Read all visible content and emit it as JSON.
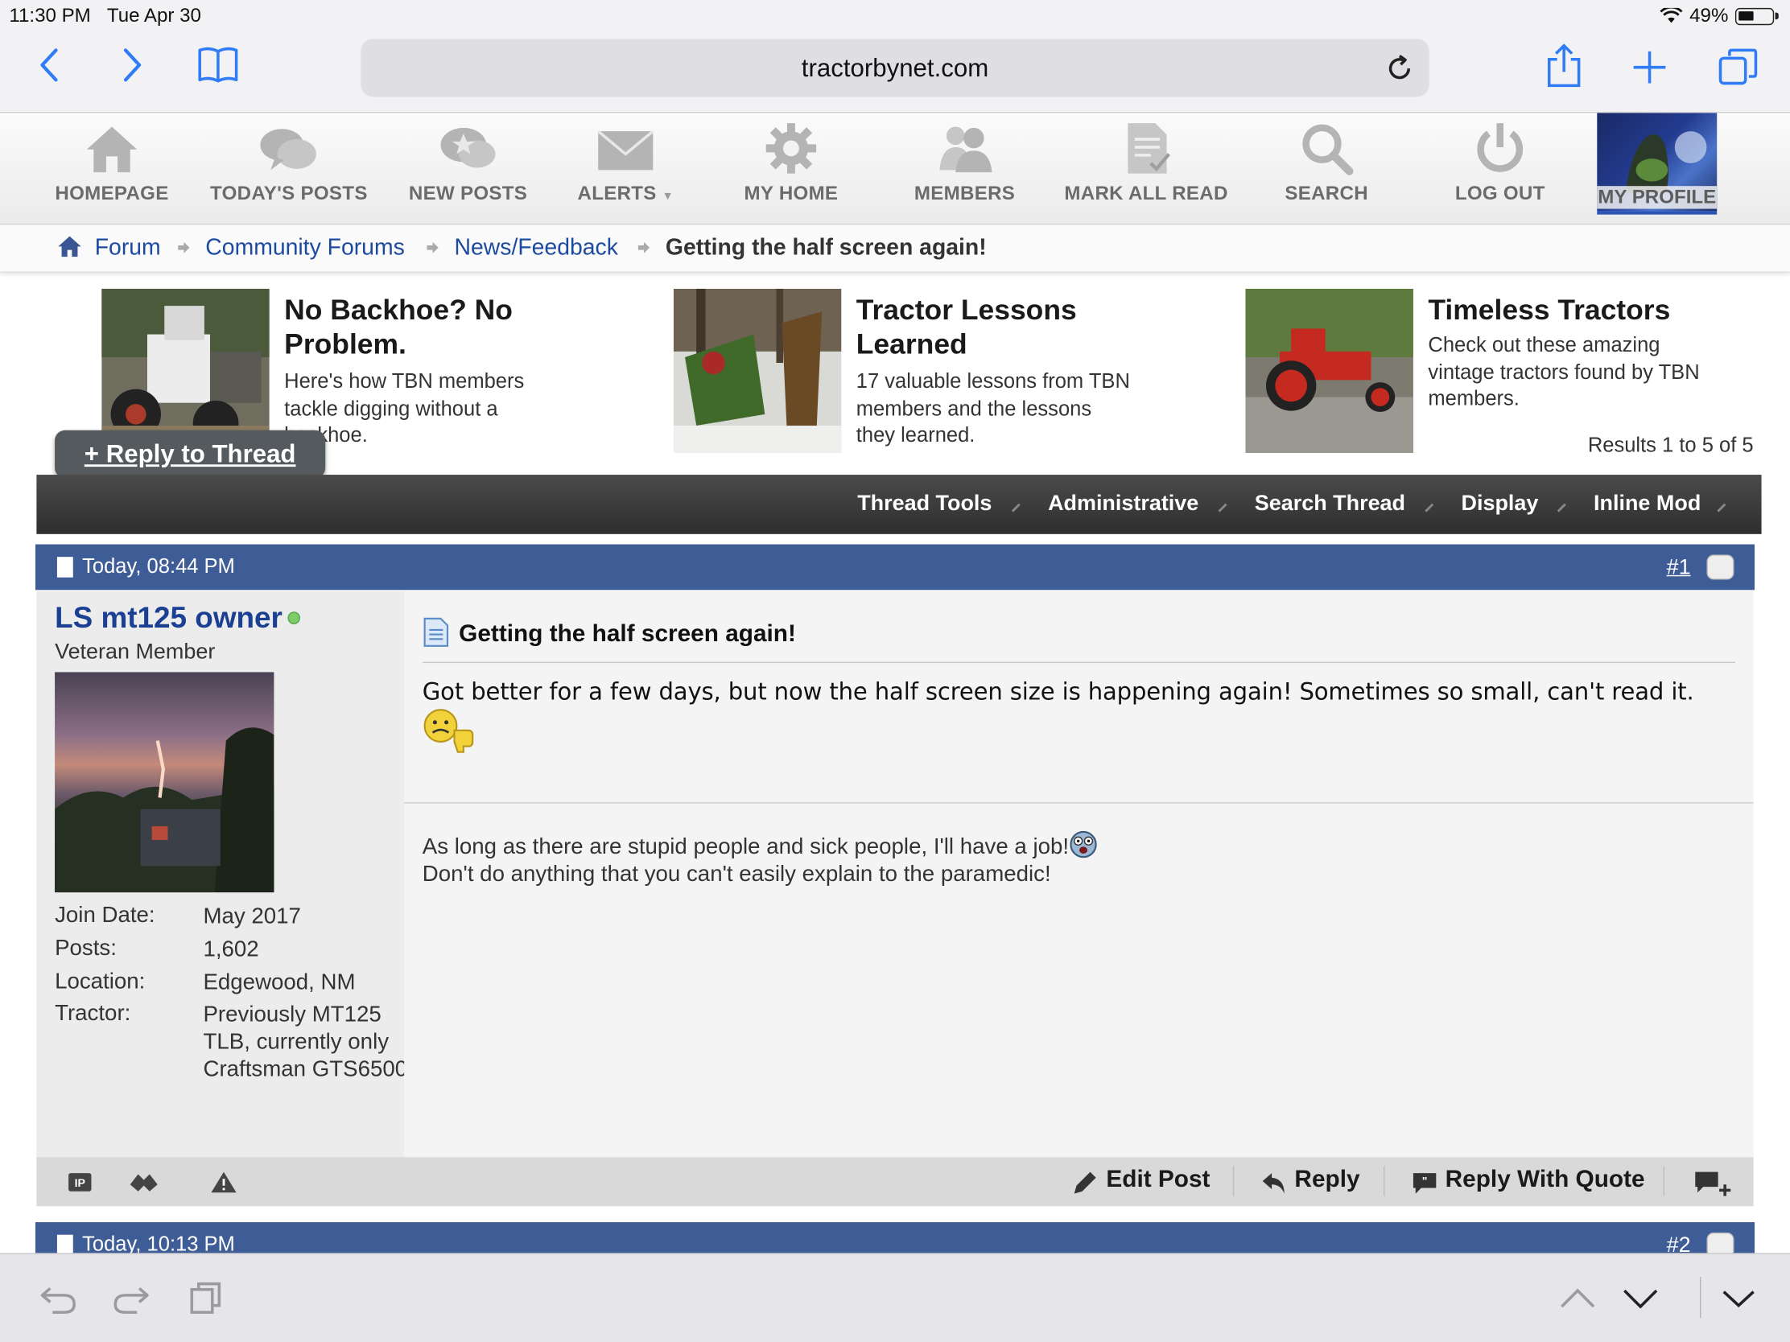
{
  "status": {
    "time": "11:30 PM",
    "date": "Tue Apr 30",
    "battery": "49%"
  },
  "browser": {
    "url": "tractorbynet.com"
  },
  "nav": {
    "items": [
      {
        "label": "HOMEPAGE"
      },
      {
        "label": "TODAY'S POSTS"
      },
      {
        "label": "NEW POSTS"
      },
      {
        "label": "ALERTS"
      },
      {
        "label": "MY HOME"
      },
      {
        "label": "MEMBERS"
      },
      {
        "label": "MARK ALL READ"
      },
      {
        "label": "SEARCH"
      },
      {
        "label": "LOG OUT"
      },
      {
        "label": "MY PROFILE"
      }
    ]
  },
  "breadcrumb": {
    "items": [
      "Forum",
      "Community Forums",
      "News/Feedback"
    ],
    "current": "Getting the half screen again!"
  },
  "promos": [
    {
      "title": "No Backhoe? No Problem.",
      "desc": "Here's how TBN members tackle digging without a backhoe."
    },
    {
      "title": "Tractor Lessons Learned",
      "desc": "17 valuable lessons from TBN members and the lessons they learned."
    },
    {
      "title": "Timeless Tractors",
      "desc": "Check out these amazing vintage tractors found by TBN members."
    }
  ],
  "thread": {
    "reply_button": "+ Reply to Thread",
    "results": "Results 1 to 5 of 5",
    "tools": [
      "Thread Tools",
      "Administrative",
      "Search Thread",
      "Display",
      "Inline Mod"
    ]
  },
  "post1": {
    "date": "Today, 08:44 PM",
    "number": "#1",
    "username": "LS mt125 owner",
    "usertitle": "Veteran Member",
    "meta": [
      {
        "label": "Join Date:",
        "value": "May 2017"
      },
      {
        "label": "Posts:",
        "value": "1,602"
      },
      {
        "label": "Location:",
        "value": "Edgewood, NM"
      },
      {
        "label": "Tractor:",
        "value": "Previously MT125 TLB, currently only Craftsman GTS6500"
      }
    ],
    "title": "Getting the half screen again!",
    "body": "Got better for a few days, but now the half screen size is happening again! Sometimes so small, can't read it.",
    "signature_line1": "As long as there are stupid people and sick people, I'll have a job!",
    "signature_line2": "Don't do anything that you can't easily explain to the paramedic!",
    "actions": [
      "Edit Post",
      "Reply",
      "Reply With Quote"
    ]
  },
  "post2": {
    "date": "Today, 10:13 PM",
    "number": "#2"
  }
}
